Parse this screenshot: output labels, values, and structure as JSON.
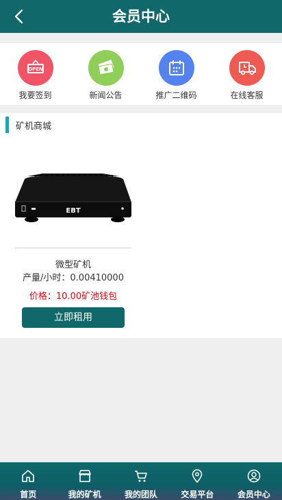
{
  "header": {
    "title": "会员中心"
  },
  "quick_links": [
    {
      "label": "我要签到",
      "color": "#ef5566",
      "icon": "open-sign-icon"
    },
    {
      "label": "新闻公告",
      "color": "#8fce58",
      "icon": "money-icon"
    },
    {
      "label": "推广二维码",
      "color": "#5482ee",
      "icon": "calendar-icon"
    },
    {
      "label": "在线客服",
      "color": "#ef5a52",
      "icon": "truck-icon"
    }
  ],
  "section": {
    "title": "矿机商城",
    "accent": "#1aa6b6",
    "product": {
      "device_text": "EBT",
      "name": "微型矿机",
      "rate": "产量/小时：0.00410000",
      "price": "价格：10.00矿池钱包",
      "rent_label": "立即租用"
    }
  },
  "tabbar": [
    {
      "label": "首页",
      "icon": "home-icon"
    },
    {
      "label": "我的矿机",
      "icon": "store-icon"
    },
    {
      "label": "我的团队",
      "icon": "cart-icon"
    },
    {
      "label": "交易平台",
      "icon": "location-icon"
    },
    {
      "label": "会员中心",
      "icon": "user-icon"
    }
  ],
  "colors": {
    "primary": "#10686a",
    "price": "#e60012"
  }
}
